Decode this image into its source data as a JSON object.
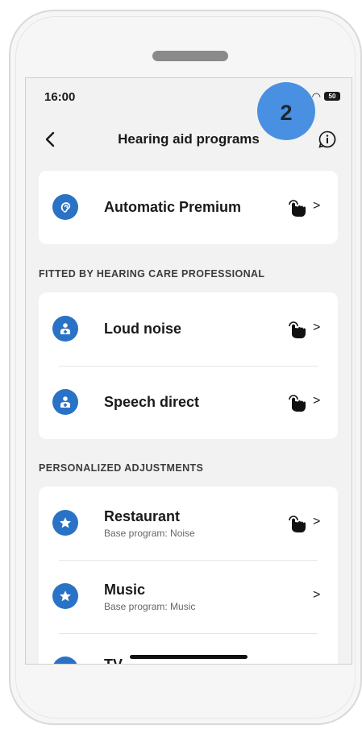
{
  "status_bar": {
    "time": "16:00",
    "battery": "50"
  },
  "step_badge": "2",
  "header": {
    "title": "Hearing aid programs"
  },
  "primary": {
    "name": "Automatic Premium"
  },
  "sections": {
    "fitted": "FITTED BY HEARING CARE PROFESSIONAL",
    "personalized": "PERSONALIZED ADJUSTMENTS"
  },
  "fitted_programs": [
    {
      "name": "Loud noise"
    },
    {
      "name": "Speech direct"
    }
  ],
  "personalized_programs": [
    {
      "name": "Restaurant",
      "subtitle": "Base program: Noise"
    },
    {
      "name": "Music",
      "subtitle": "Base program: Music"
    },
    {
      "name": "TV"
    }
  ],
  "chevron": ">",
  "colors": {
    "accent": "#2a72c5",
    "badge": "#4a90e2"
  },
  "icons": [
    "back-arrow-icon",
    "info-icon",
    "ear-icon",
    "professional-icon",
    "star-icon",
    "hand-tap-icon",
    "chevron-right-icon"
  ]
}
